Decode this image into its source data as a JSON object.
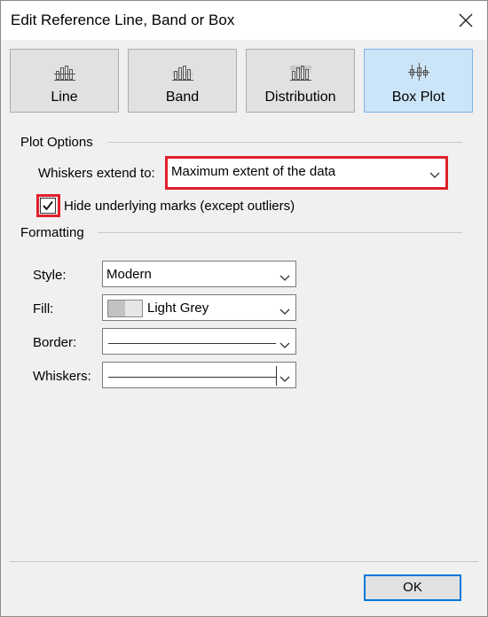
{
  "dialog": {
    "title": "Edit Reference Line, Band or Box"
  },
  "types": [
    {
      "label": "Line",
      "icon": "line-chart-icon",
      "selected": false
    },
    {
      "label": "Band",
      "icon": "band-chart-icon",
      "selected": false
    },
    {
      "label": "Distribution",
      "icon": "distribution-chart-icon",
      "selected": false
    },
    {
      "label": "Box Plot",
      "icon": "box-plot-icon",
      "selected": true
    }
  ],
  "plot_options": {
    "heading": "Plot Options",
    "whiskers_label": "Whiskers extend to:",
    "whiskers_value": "Maximum extent of the data",
    "hide_marks_label": "Hide underlying marks (except outliers)",
    "hide_marks_checked": true
  },
  "formatting": {
    "heading": "Formatting",
    "style_label": "Style:",
    "style_value": "Modern",
    "fill_label": "Fill:",
    "fill_value": "Light Grey",
    "border_label": "Border:",
    "whiskers_label": "Whiskers:"
  },
  "footer": {
    "ok_label": "OK"
  },
  "colors": {
    "selected_bg": "#cce4f7",
    "highlight_red": "#e0202a",
    "ok_border": "#0078d7"
  }
}
